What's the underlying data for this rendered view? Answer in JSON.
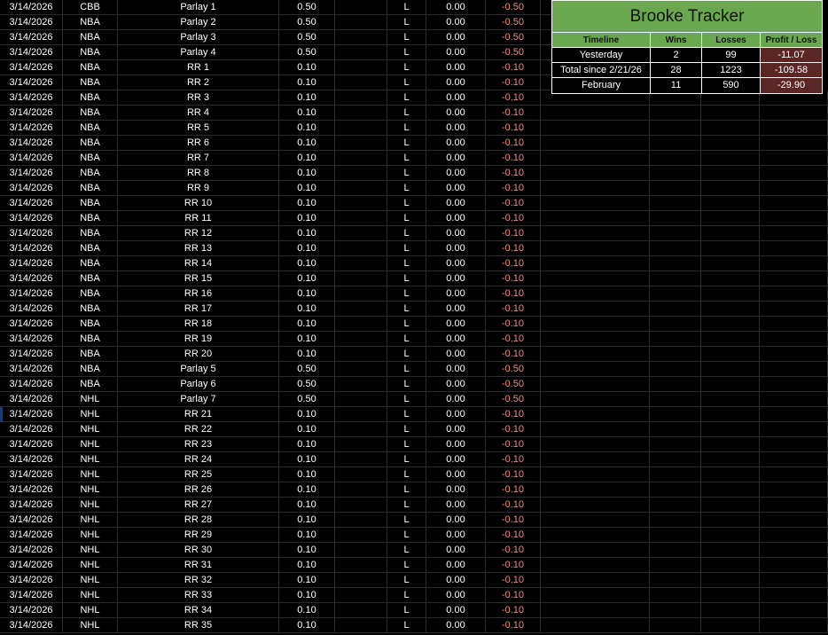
{
  "sheet": {
    "rows": [
      {
        "date": "3/14/2026",
        "league": "CBB",
        "bet": "Parlay 1",
        "stake": "0.50",
        "result": "L",
        "payout": "0.00",
        "pl": "-0.50"
      },
      {
        "date": "3/14/2026",
        "league": "NBA",
        "bet": "Parlay 2",
        "stake": "0.50",
        "result": "L",
        "payout": "0.00",
        "pl": "-0.50"
      },
      {
        "date": "3/14/2026",
        "league": "NBA",
        "bet": "Parlay 3",
        "stake": "0.50",
        "result": "L",
        "payout": "0.00",
        "pl": "-0.50"
      },
      {
        "date": "3/14/2026",
        "league": "NBA",
        "bet": "Parlay 4",
        "stake": "0.50",
        "result": "L",
        "payout": "0.00",
        "pl": "-0.50"
      },
      {
        "date": "3/14/2026",
        "league": "NBA",
        "bet": "RR 1",
        "stake": "0.10",
        "result": "L",
        "payout": "0.00",
        "pl": "-0.10"
      },
      {
        "date": "3/14/2026",
        "league": "NBA",
        "bet": "RR 2",
        "stake": "0.10",
        "result": "L",
        "payout": "0.00",
        "pl": "-0.10"
      },
      {
        "date": "3/14/2026",
        "league": "NBA",
        "bet": "RR 3",
        "stake": "0.10",
        "result": "L",
        "payout": "0.00",
        "pl": "-0.10"
      },
      {
        "date": "3/14/2026",
        "league": "NBA",
        "bet": "RR 4",
        "stake": "0.10",
        "result": "L",
        "payout": "0.00",
        "pl": "-0.10"
      },
      {
        "date": "3/14/2026",
        "league": "NBA",
        "bet": "RR 5",
        "stake": "0.10",
        "result": "L",
        "payout": "0.00",
        "pl": "-0.10"
      },
      {
        "date": "3/14/2026",
        "league": "NBA",
        "bet": "RR 6",
        "stake": "0.10",
        "result": "L",
        "payout": "0.00",
        "pl": "-0.10"
      },
      {
        "date": "3/14/2026",
        "league": "NBA",
        "bet": "RR 7",
        "stake": "0.10",
        "result": "L",
        "payout": "0.00",
        "pl": "-0.10"
      },
      {
        "date": "3/14/2026",
        "league": "NBA",
        "bet": "RR 8",
        "stake": "0.10",
        "result": "L",
        "payout": "0.00",
        "pl": "-0.10"
      },
      {
        "date": "3/14/2026",
        "league": "NBA",
        "bet": "RR 9",
        "stake": "0.10",
        "result": "L",
        "payout": "0.00",
        "pl": "-0.10"
      },
      {
        "date": "3/14/2026",
        "league": "NBA",
        "bet": "RR 10",
        "stake": "0.10",
        "result": "L",
        "payout": "0.00",
        "pl": "-0.10"
      },
      {
        "date": "3/14/2026",
        "league": "NBA",
        "bet": "RR 11",
        "stake": "0.10",
        "result": "L",
        "payout": "0.00",
        "pl": "-0.10"
      },
      {
        "date": "3/14/2026",
        "league": "NBA",
        "bet": "RR 12",
        "stake": "0.10",
        "result": "L",
        "payout": "0.00",
        "pl": "-0.10"
      },
      {
        "date": "3/14/2026",
        "league": "NBA",
        "bet": "RR 13",
        "stake": "0.10",
        "result": "L",
        "payout": "0.00",
        "pl": "-0.10"
      },
      {
        "date": "3/14/2026",
        "league": "NBA",
        "bet": "RR 14",
        "stake": "0.10",
        "result": "L",
        "payout": "0.00",
        "pl": "-0.10"
      },
      {
        "date": "3/14/2026",
        "league": "NBA",
        "bet": "RR 15",
        "stake": "0.10",
        "result": "L",
        "payout": "0.00",
        "pl": "-0.10"
      },
      {
        "date": "3/14/2026",
        "league": "NBA",
        "bet": "RR 16",
        "stake": "0.10",
        "result": "L",
        "payout": "0.00",
        "pl": "-0.10"
      },
      {
        "date": "3/14/2026",
        "league": "NBA",
        "bet": "RR 17",
        "stake": "0.10",
        "result": "L",
        "payout": "0.00",
        "pl": "-0.10"
      },
      {
        "date": "3/14/2026",
        "league": "NBA",
        "bet": "RR 18",
        "stake": "0.10",
        "result": "L",
        "payout": "0.00",
        "pl": "-0.10"
      },
      {
        "date": "3/14/2026",
        "league": "NBA",
        "bet": "RR 19",
        "stake": "0.10",
        "result": "L",
        "payout": "0.00",
        "pl": "-0.10"
      },
      {
        "date": "3/14/2026",
        "league": "NBA",
        "bet": "RR 20",
        "stake": "0.10",
        "result": "L",
        "payout": "0.00",
        "pl": "-0.10"
      },
      {
        "date": "3/14/2026",
        "league": "NBA",
        "bet": "Parlay 5",
        "stake": "0.50",
        "result": "L",
        "payout": "0.00",
        "pl": "-0.50"
      },
      {
        "date": "3/14/2026",
        "league": "NBA",
        "bet": "Parlay 6",
        "stake": "0.50",
        "result": "L",
        "payout": "0.00",
        "pl": "-0.50"
      },
      {
        "date": "3/14/2026",
        "league": "NHL",
        "bet": "Parlay 7",
        "stake": "0.50",
        "result": "L",
        "payout": "0.00",
        "pl": "-0.50"
      },
      {
        "date": "3/14/2026",
        "league": "NHL",
        "bet": "RR 21",
        "stake": "0.10",
        "result": "L",
        "payout": "0.00",
        "pl": "-0.10"
      },
      {
        "date": "3/14/2026",
        "league": "NHL",
        "bet": "RR 22",
        "stake": "0.10",
        "result": "L",
        "payout": "0.00",
        "pl": "-0.10"
      },
      {
        "date": "3/14/2026",
        "league": "NHL",
        "bet": "RR 23",
        "stake": "0.10",
        "result": "L",
        "payout": "0.00",
        "pl": "-0.10"
      },
      {
        "date": "3/14/2026",
        "league": "NHL",
        "bet": "RR 24",
        "stake": "0.10",
        "result": "L",
        "payout": "0.00",
        "pl": "-0.10"
      },
      {
        "date": "3/14/2026",
        "league": "NHL",
        "bet": "RR 25",
        "stake": "0.10",
        "result": "L",
        "payout": "0.00",
        "pl": "-0.10"
      },
      {
        "date": "3/14/2026",
        "league": "NHL",
        "bet": "RR 26",
        "stake": "0.10",
        "result": "L",
        "payout": "0.00",
        "pl": "-0.10"
      },
      {
        "date": "3/14/2026",
        "league": "NHL",
        "bet": "RR 27",
        "stake": "0.10",
        "result": "L",
        "payout": "0.00",
        "pl": "-0.10"
      },
      {
        "date": "3/14/2026",
        "league": "NHL",
        "bet": "RR 28",
        "stake": "0.10",
        "result": "L",
        "payout": "0.00",
        "pl": "-0.10"
      },
      {
        "date": "3/14/2026",
        "league": "NHL",
        "bet": "RR 29",
        "stake": "0.10",
        "result": "L",
        "payout": "0.00",
        "pl": "-0.10"
      },
      {
        "date": "3/14/2026",
        "league": "NHL",
        "bet": "RR 30",
        "stake": "0.10",
        "result": "L",
        "payout": "0.00",
        "pl": "-0.10"
      },
      {
        "date": "3/14/2026",
        "league": "NHL",
        "bet": "RR 31",
        "stake": "0.10",
        "result": "L",
        "payout": "0.00",
        "pl": "-0.10"
      },
      {
        "date": "3/14/2026",
        "league": "NHL",
        "bet": "RR 32",
        "stake": "0.10",
        "result": "L",
        "payout": "0.00",
        "pl": "-0.10"
      },
      {
        "date": "3/14/2026",
        "league": "NHL",
        "bet": "RR 33",
        "stake": "0.10",
        "result": "L",
        "payout": "0.00",
        "pl": "-0.10"
      },
      {
        "date": "3/14/2026",
        "league": "NHL",
        "bet": "RR 34",
        "stake": "0.10",
        "result": "L",
        "payout": "0.00",
        "pl": "-0.10"
      },
      {
        "date": "3/14/2026",
        "league": "NHL",
        "bet": "RR 35",
        "stake": "0.10",
        "result": "L",
        "payout": "0.00",
        "pl": "-0.10"
      }
    ]
  },
  "tracker": {
    "title": "Brooke Tracker",
    "headers": [
      "Timeline",
      "Wins",
      "Losses",
      "Profit / Loss"
    ],
    "rows": [
      {
        "timeline": "Yesterday",
        "wins": "2",
        "losses": "99",
        "pl": "-11.07"
      },
      {
        "timeline": "Total since 2/21/26",
        "wins": "28",
        "losses": "1223",
        "pl": "-109.58"
      },
      {
        "timeline": "February",
        "wins": "11",
        "losses": "590",
        "pl": "-29.90"
      }
    ]
  },
  "colors": {
    "background": "#000000",
    "header_green": "#6aa84f",
    "negative_text": "#f08a8a",
    "negative_fill": "#5b2623",
    "gridline": "#2b2b2b"
  }
}
